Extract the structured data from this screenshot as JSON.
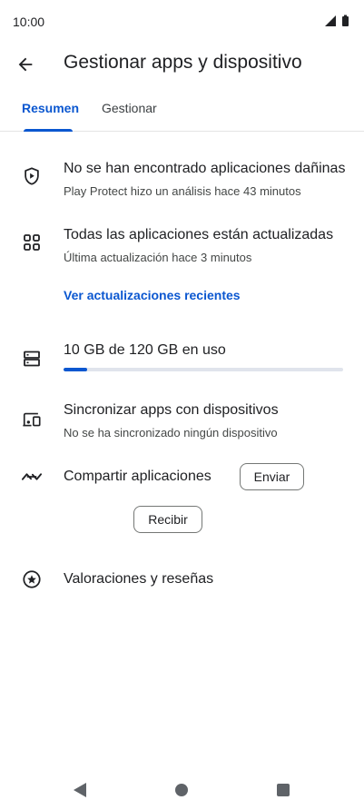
{
  "status_bar": {
    "time": "10:00",
    "icons": [
      "signal-icon",
      "battery-icon"
    ]
  },
  "app_bar": {
    "back_icon": "arrow-back-icon",
    "title": "Gestionar apps y dispositivo"
  },
  "tabs": [
    {
      "label": "Resumen",
      "selected": true
    },
    {
      "label": "Gestionar",
      "selected": false
    }
  ],
  "protect": {
    "icon": "shield-icon",
    "title": "No se han encontrado aplicaciones dañinas",
    "subtitle": "Play Protect hizo un análisis hace 43 minutos"
  },
  "updates": {
    "icon": "apps-grid-icon",
    "title": "Todas las aplicaciones están actualizadas",
    "subtitle": "Última actualización hace 3 minutos",
    "link": "Ver actualizaciones recientes"
  },
  "storage": {
    "icon": "storage-icon",
    "title": "10 GB de 120 GB en uso",
    "used_fraction": 0.083
  },
  "sync": {
    "icon": "devices-icon",
    "title": "Sincronizar apps con dispositivos",
    "subtitle": "No se ha sincronizado ningún dispositivo"
  },
  "share": {
    "icon": "nearby-share-icon",
    "title": "Compartir aplicaciones",
    "send_label": "Enviar",
    "receive_label": "Recibir"
  },
  "ratings": {
    "icon": "star-circle-icon",
    "title": "Valoraciones y reseñas"
  },
  "nav_bar": {
    "back_icon": "nav-back-icon",
    "home_icon": "nav-home-icon",
    "recents_icon": "nav-recents-icon"
  },
  "colors": {
    "accent": "#0b57d0",
    "text_primary": "#202124",
    "text_secondary": "#444746",
    "divider": "#e4e4e4"
  }
}
